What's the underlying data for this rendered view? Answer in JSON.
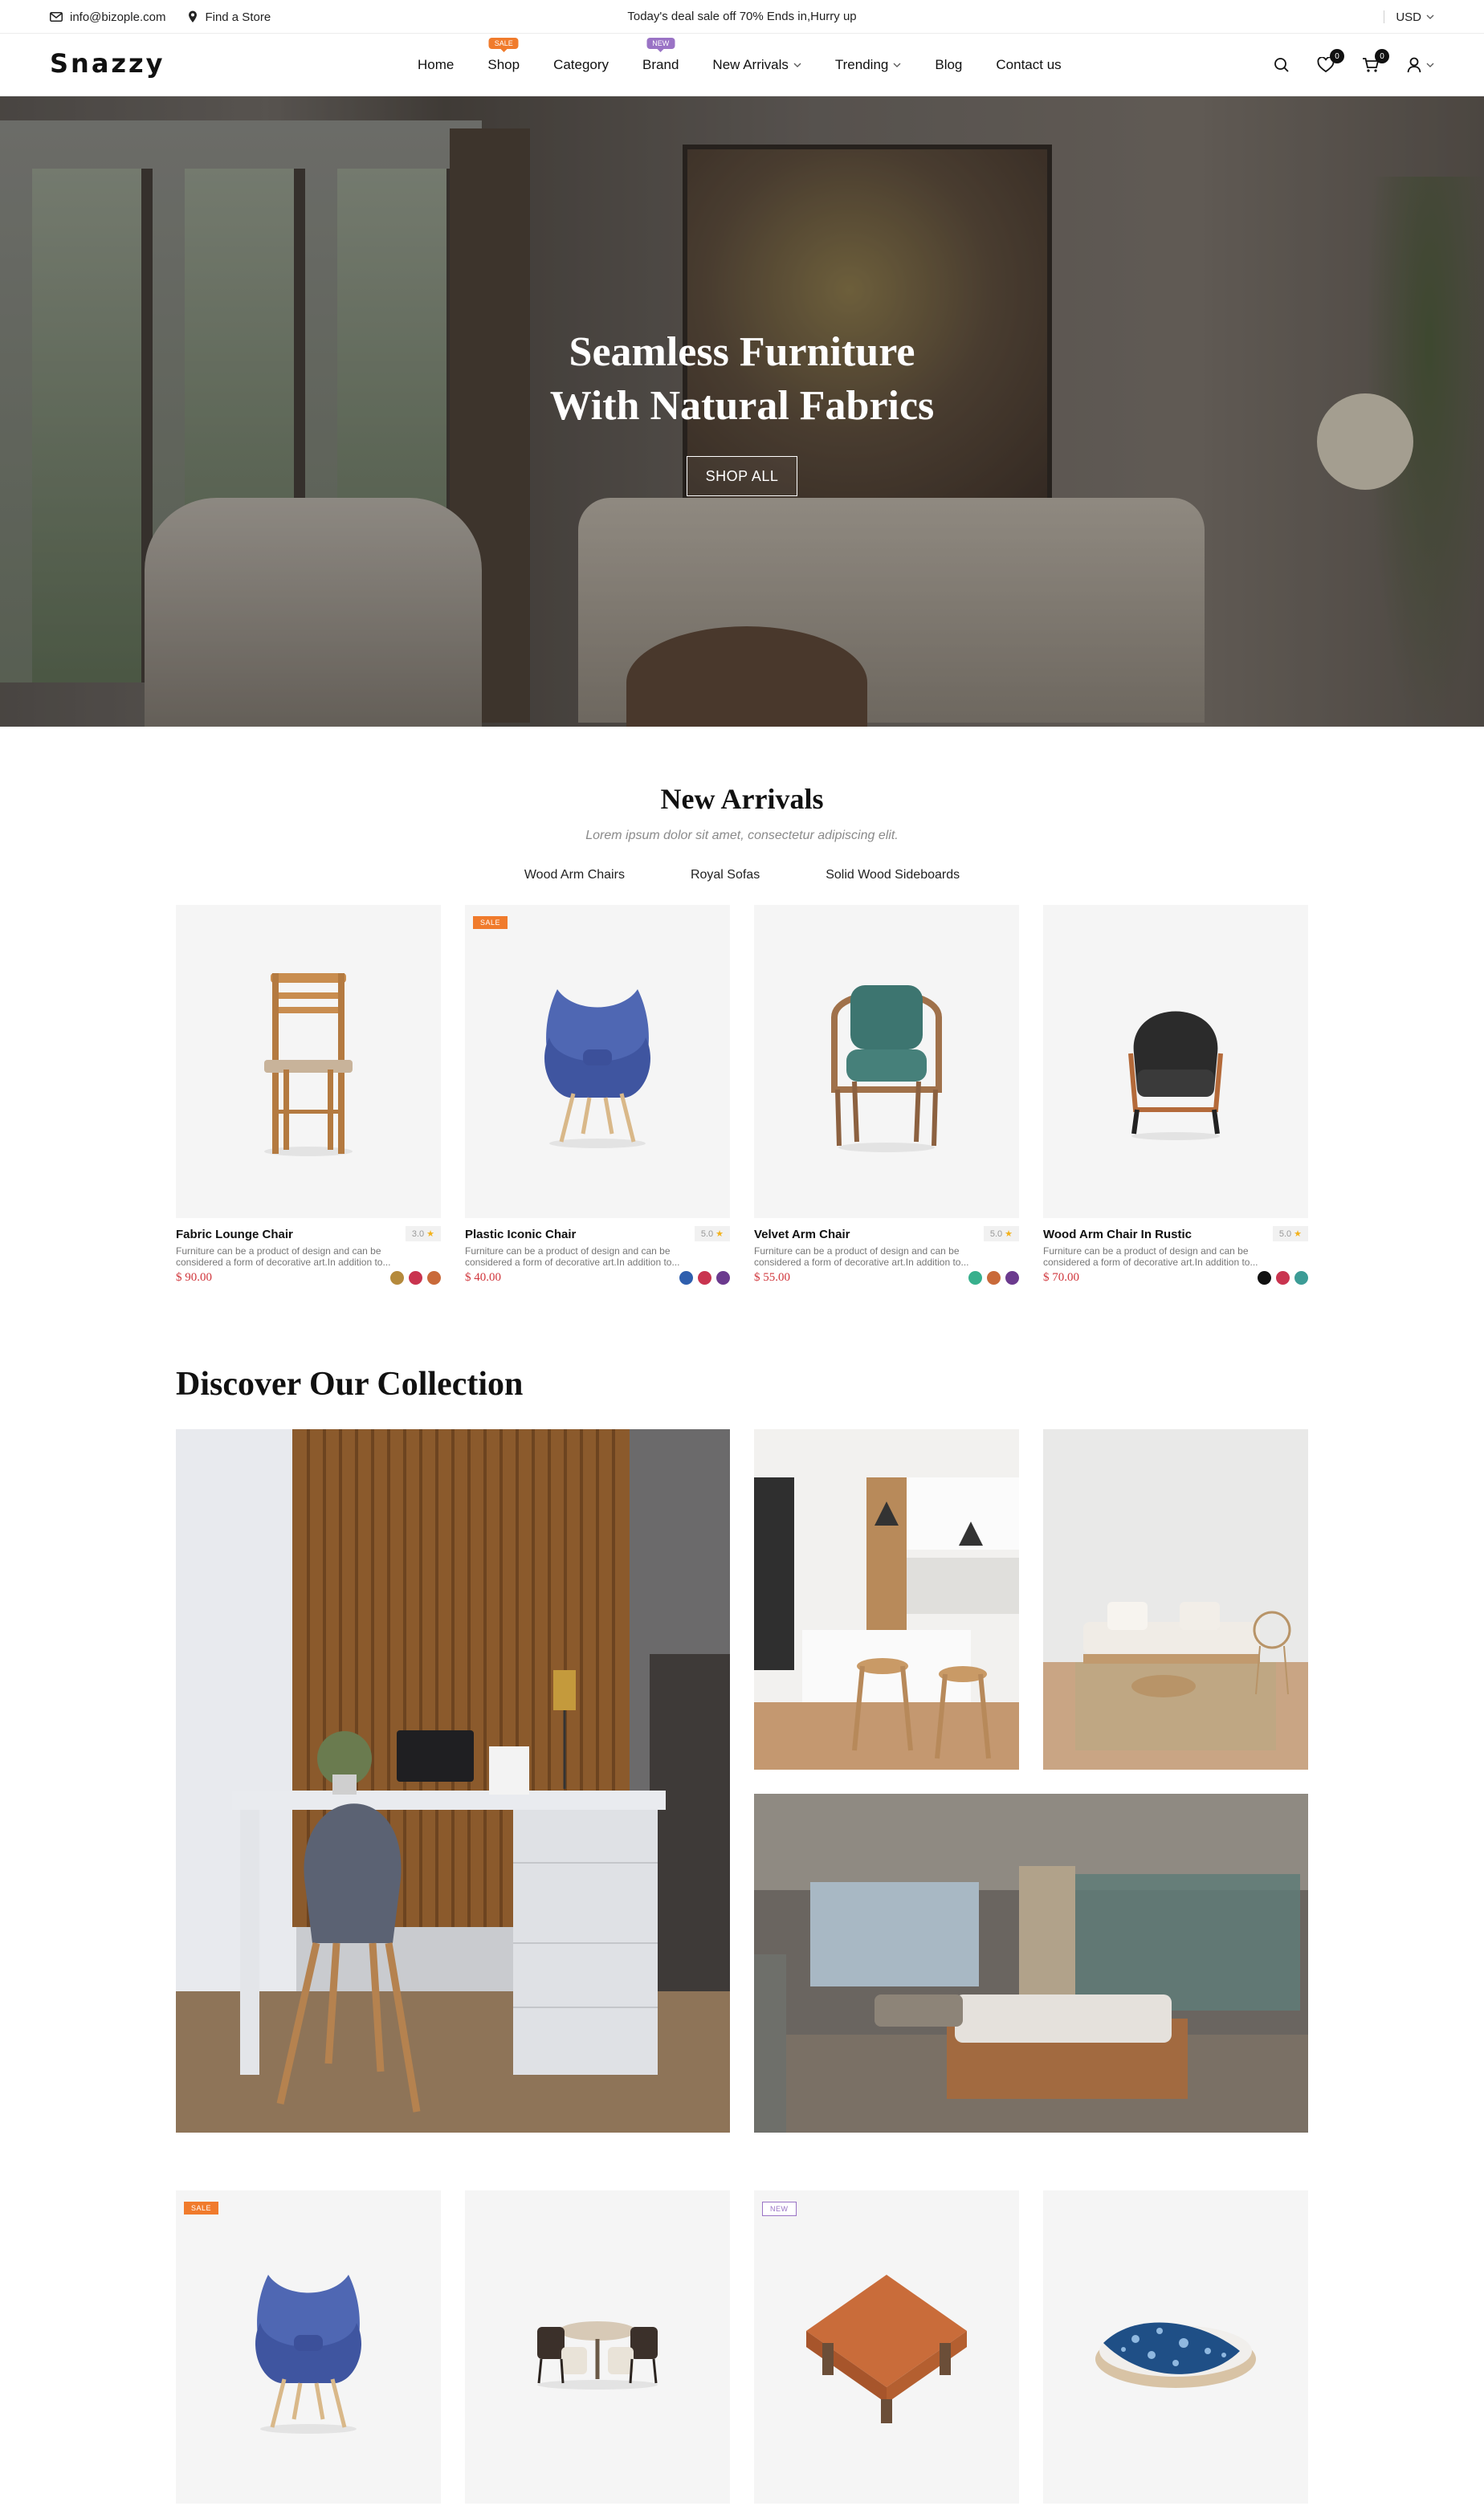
{
  "topbar": {
    "email": "info@bizople.com",
    "store": "Find a Store",
    "promo": "Today's deal sale off 70% Ends in,Hurry up",
    "currency": "USD"
  },
  "header": {
    "logo": "Snazzy",
    "nav": [
      {
        "label": "Home"
      },
      {
        "label": "Shop",
        "badge": "SALE"
      },
      {
        "label": "Category"
      },
      {
        "label": "Brand",
        "badge": "NEW"
      },
      {
        "label": "New Arrivals"
      },
      {
        "label": "Trending"
      },
      {
        "label": "Blog"
      },
      {
        "label": "Contact us"
      }
    ],
    "wishlist_count": "0",
    "cart_count": "0"
  },
  "hero": {
    "title_line1": "Seamless Furniture",
    "title_line2": "With Natural Fabrics",
    "button": "SHOP ALL"
  },
  "new_arrivals": {
    "title": "New Arrivals",
    "subtitle": "Lorem ipsum dolor sit amet, consectetur adipiscing elit.",
    "tabs": [
      "Wood Arm Chairs",
      "Royal Sofas",
      "Solid Wood Sideboards"
    ],
    "products": [
      {
        "name": "Fabric Lounge Chair",
        "rating": "3.0",
        "desc": "Furniture can be a product of design and can be considered a form of decorative art.In addition to...",
        "price": "$ 90.00",
        "tag": "",
        "colors": [
          "#b58a3c",
          "#c9344f",
          "#c96a3a"
        ]
      },
      {
        "name": "Plastic Iconic Chair",
        "rating": "5.0",
        "desc": "Furniture can be a product of design and can be considered a form of decorative art.In addition to...",
        "price": "$ 40.00",
        "tag": "SALE",
        "colors": [
          "#2f5fae",
          "#c9344f",
          "#6b3a8e"
        ]
      },
      {
        "name": "Velvet Arm Chair",
        "rating": "5.0",
        "desc": "Furniture can be a product of design and can be considered a form of decorative art.In addition to...",
        "price": "$ 55.00",
        "tag": "",
        "colors": [
          "#38b08d",
          "#c96a3a",
          "#6b3a8e"
        ]
      },
      {
        "name": "Wood Arm Chair In Rustic",
        "rating": "5.0",
        "desc": "Furniture can be a product of design and can be considered a form of decorative art.In addition to...",
        "price": "$ 70.00",
        "tag": "",
        "colors": [
          "#111111",
          "#c9344f",
          "#3c9c96"
        ]
      }
    ]
  },
  "collection": {
    "title": "Discover Our Collection",
    "bottom_tags": [
      "SALE",
      "",
      "NEW",
      ""
    ]
  },
  "colors": {
    "accent_sale": "#f07b2c",
    "accent_new": "#9a73c5",
    "price": "#d0353b"
  }
}
